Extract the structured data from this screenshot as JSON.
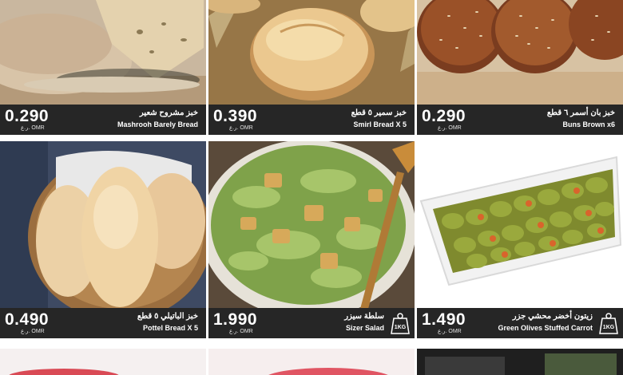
{
  "colors": {
    "bar": "#262626",
    "text": "#ffffff",
    "background": "#ffffff"
  },
  "products": [
    {
      "name_ar": "خبز مشروح شعير",
      "name_en": "Mashrooh Barely Bread",
      "price": "0.290",
      "currency": "ر.ع. OMR",
      "image": "flatbread-photo"
    },
    {
      "name_ar": "خبز سمير ٥ قطع",
      "name_en": "Smirl Bread X 5",
      "price": "0.390",
      "currency": "ر.ع. OMR",
      "image": "bread-roll-photo"
    },
    {
      "name_ar": "خبز بان أسمر ٦ قطع",
      "name_en": "Buns Brown x6",
      "price": "0.290",
      "currency": "ر.ع. OMR",
      "image": "sesame-buns-photo"
    },
    {
      "name_ar": "خبز الباتيلي ٥ قطع",
      "name_en": "Pottel Bread X 5",
      "price": "0.490",
      "currency": "ر.ع. OMR",
      "image": "bread-basket-photo"
    },
    {
      "name_ar": "سلطة سيزر",
      "name_en": "Sizer Salad",
      "price": "1.990",
      "currency": "ر.ع. OMR",
      "image": "caesar-salad-photo",
      "badge": "1KG"
    },
    {
      "name_ar": "زيتون أخضر محشي جزر",
      "name_en": "Green Olives Stuffed Carrot",
      "price": "1.490",
      "currency": "ر.ع. OMR",
      "image": "green-olives-photo",
      "badge": "1KG"
    }
  ]
}
